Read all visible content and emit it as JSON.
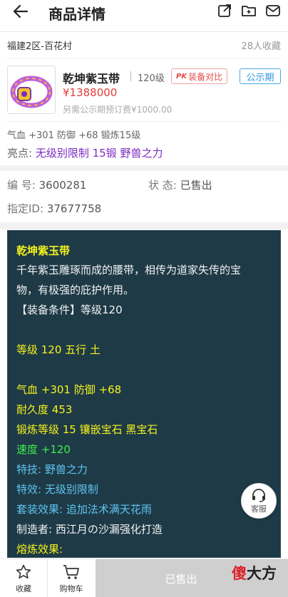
{
  "header": {
    "title": "商品详情"
  },
  "server": {
    "name": "福建2区-百花村",
    "fav_count": "28人收藏"
  },
  "product": {
    "name": "乾坤紫玉带",
    "level": "120级",
    "compare_label": "装备对比",
    "compare_badge": "PK",
    "public_badge": "公示期",
    "price": "¥1388000",
    "deposit": "另需公示期预订费¥1000.00",
    "stats": "气血 +301 防御 +68 锻炼15级",
    "highlights_label": "亮点:",
    "highlights": [
      "无级别限制",
      "15锻",
      "野兽之力"
    ]
  },
  "info": {
    "id_label": "编  号:",
    "id_value": "3600281",
    "status_label": "状  态:",
    "status_value": "已售出",
    "spec_label": "指定ID:",
    "spec_value": "37677758"
  },
  "detail": {
    "lines": [
      {
        "text": "乾坤紫玉带",
        "color": "yellow",
        "bold": true
      },
      {
        "text": "千年紫玉雕琢而成的腰带，相传为道家失传的宝",
        "color": "white"
      },
      {
        "text": "物，有极强的庇护作用。",
        "color": "white"
      },
      {
        "text": "【装备条件】等级120",
        "color": "white"
      },
      {
        "text": "",
        "color": "white"
      },
      {
        "text": "等级 120 五行 土",
        "color": "yellow"
      },
      {
        "text": "",
        "color": "white"
      },
      {
        "text": "气血 +301 防御 +68",
        "color": "yellow"
      },
      {
        "text": "耐久度 453",
        "color": "yellow"
      },
      {
        "text": "锻炼等级 15 镶嵌宝石 黑宝石",
        "color": "yellow"
      },
      {
        "text": "速度 +120",
        "color": "green"
      },
      {
        "text": "特技: 野兽之力",
        "color": "cyan"
      },
      {
        "text": "特效: 无级别限制",
        "color": "cyan"
      },
      {
        "text": "套装效果: 追加法术满天花雨",
        "color": "cyan"
      },
      {
        "text": "制造者: 西江月の沙漏强化打造",
        "color": "white"
      },
      {
        "text": "熔炼效果:",
        "color": "yellow"
      }
    ],
    "colors": {
      "yellow": "#f5f31c",
      "white": "#f2f2f2",
      "green": "#3ef04a",
      "cyan": "#5fc4f0",
      "panel_bg": "#1e3a47"
    }
  },
  "customer_service": {
    "label": "客服",
    "icon": "headset-icon"
  },
  "bottom_bar": {
    "favorite_label": "收藏",
    "cart_label": "购物车",
    "sold_label": "已售出",
    "watermark_red": "傻",
    "watermark_black": "大方"
  }
}
